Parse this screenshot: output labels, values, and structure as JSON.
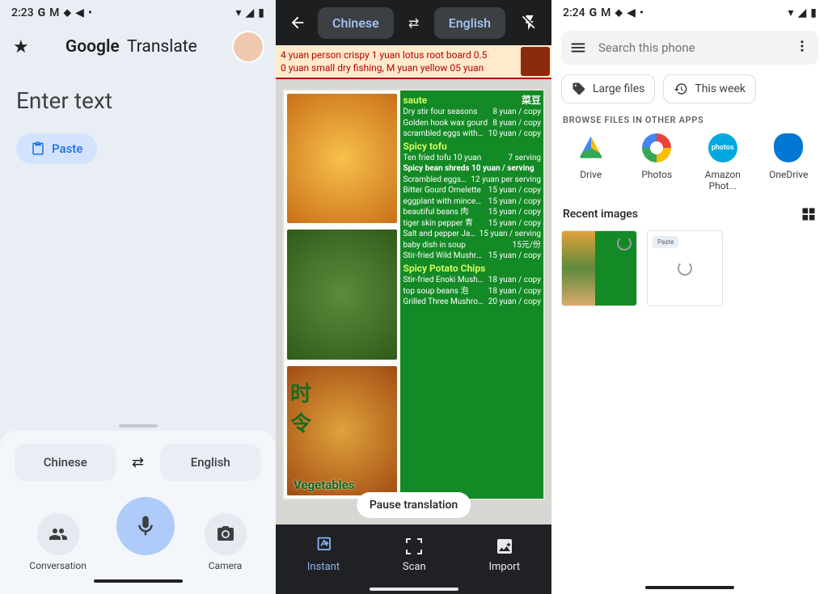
{
  "pane1": {
    "status_time": "2:23",
    "app_title_bold": "Google",
    "app_title_rest": "Translate",
    "enter_text": "Enter text",
    "paste": "Paste",
    "lang_from": "Chinese",
    "lang_to": "English",
    "action_conversation": "Conversation",
    "action_camera": "Camera"
  },
  "pane2": {
    "lang_from": "Chinese",
    "lang_to": "English",
    "banner_line1": "4 yuan person crispy 1 yuan lotus root board 0.5",
    "banner_line2": "0 yuan small dry fishing, M yuan yellow 05 yuan",
    "veg_label": "Vegetables",
    "menu_rows": [
      {
        "l": "saute",
        "r": "菜豆",
        "cls": "hl"
      },
      {
        "l": "Dry stir four seasons",
        "r": "8 yuan / copy"
      },
      {
        "l": "Golden hook wax gourd",
        "r": "8 yuan / copy"
      },
      {
        "l": "scrambled eggs with tomatoes",
        "r": "10 yuan / copy"
      },
      {
        "l": "Spicy tofu",
        "r": "",
        "cls": "hl"
      },
      {
        "l": "Ten fried tofu 10 yuan",
        "r": "7 serving"
      },
      {
        "l": "Spicy bean shreds 10 yuan / serving",
        "r": "",
        "cls": "bold"
      },
      {
        "l": "Scrambled eggs with chives",
        "r": "12 yuan per serving"
      },
      {
        "l": "Bitter Gourd Omelette",
        "r": "15 yuan / copy"
      },
      {
        "l": "eggplant with minced meat 十沫",
        "r": "15 yuan / copy"
      },
      {
        "l": "beautiful beans  肉",
        "r": "15 yuan / copy"
      },
      {
        "l": "tiger skin pepper 青",
        "r": "15 yuan / copy"
      },
      {
        "l": "Salt and pepper Japanese tofu",
        "r": "15 yuan / serving"
      },
      {
        "l": "baby dish in soup",
        "r": "15元/份"
      },
      {
        "l": "Stir-fried Wild Mushrooms",
        "r": "15 yuan / copy"
      },
      {
        "l": "Spicy Potato Chips",
        "r": "",
        "cls": "hl"
      },
      {
        "l": "Stir-fried Enoki Mushrooms",
        "r": "18 yuan / copy"
      },
      {
        "l": "top soup beans 泡",
        "r": "18 yuan / copy"
      },
      {
        "l": "Grilled Three Mushrooms with Vegetable",
        "r": "20 yuan / copy"
      }
    ],
    "pause": "Pause translation",
    "tab_instant": "Instant",
    "tab_scan": "Scan",
    "tab_import": "Import"
  },
  "pane3": {
    "status_time": "2:24",
    "search_placeholder": "Search this phone",
    "filter_large": "Large files",
    "filter_week": "This week",
    "section_browse": "BROWSE FILES IN OTHER APPS",
    "apps": [
      "Drive",
      "Photos",
      "Amazon Phot...",
      "OneDrive"
    ],
    "amzn_inner": "photos",
    "recent_title": "Recent images",
    "paste_mini": "Paste"
  }
}
